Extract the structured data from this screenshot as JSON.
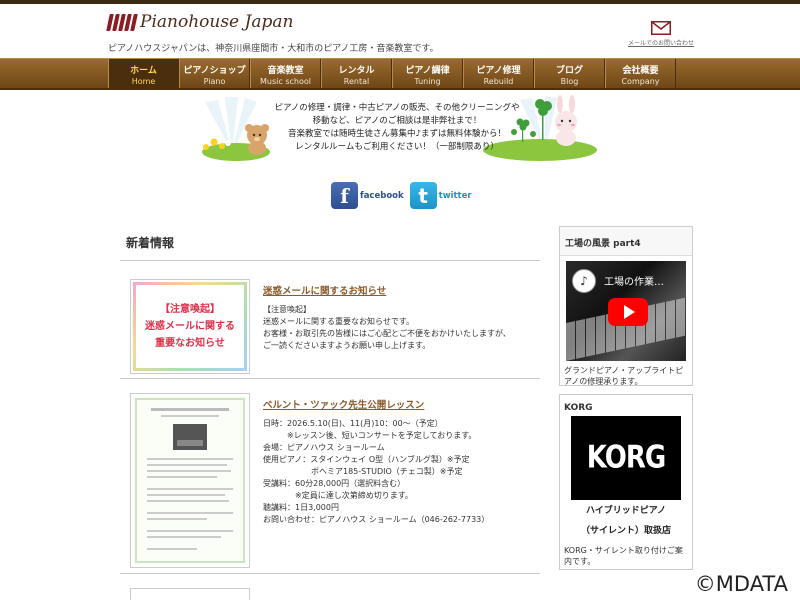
{
  "header": {
    "logo_text": "Pianohouse Japan",
    "tagline": "ピアノハウスジャパンは、神奈川県座間市・大和市のピアノ工房・音楽教室です。",
    "mail_label": "メールでのお問い合わせ",
    "mail_icon": "envelope-icon"
  },
  "nav": [
    {
      "jp": "ホーム",
      "en": "Home"
    },
    {
      "jp": "ピアノショップ",
      "en": "Piano"
    },
    {
      "jp": "音楽教室",
      "en": "Music school"
    },
    {
      "jp": "レンタル",
      "en": "Rental"
    },
    {
      "jp": "ピアノ調律",
      "en": "Tuning"
    },
    {
      "jp": "ピアノ修理",
      "en": "Rebuild"
    },
    {
      "jp": "ブログ",
      "en": "Blog"
    },
    {
      "jp": "会社概要",
      "en": "Company"
    }
  ],
  "hero": {
    "lines": [
      "ピアノの修理・調律・中古ピアノの販売、その他クリーニングや",
      "移動など、ピアノのご相談は是非弊社まで！",
      "音楽教室では随時生徒さん募集中♪まずは無料体験から！",
      "レンタルルームもご利用ください！（一部制限あり）"
    ]
  },
  "social": {
    "facebook_label": "facebook",
    "twitter_label": "twitter",
    "facebook_glyph": "f",
    "twitter_glyph": "t"
  },
  "news": {
    "title": "新着情報",
    "posts": [
      {
        "title": "迷惑メールに関するお知らせ",
        "thumb_lines": [
          "【注意喚起】",
          "迷惑メールに関する",
          "重要なお知らせ"
        ],
        "body": [
          "【注意喚起】",
          "迷惑メールに関する重要なお知らせです。",
          "お客様・お取引先の皆様にはご心配とご不便をおかけいたしますが、",
          "ご一読くださいますようお願い申し上げます。"
        ]
      },
      {
        "title": "ベルント・ツァック先生公開レッスン",
        "body": [
          "日時：2026.5.10(日)、11(月)10：00～（予定）",
          "　　　※レッスン後、短いコンサートを予定しております。",
          "会場：ピアノハウス ショールーム",
          "使用ピアノ：スタインウェイ O型（ハンブルグ製）※予定",
          "　　　　　　ボヘミア185-STUDIO（チェコ製）※予定",
          "受講料：60分28,000円（選択料含む）",
          "　　　　※定員に達し次第締め切ります。",
          "聴講料：1日3,000円",
          "お問い合わせ：ピアノハウス ショールーム（046-262-7733）"
        ]
      }
    ]
  },
  "sidebar": {
    "factory_title": "工場の風景 part4",
    "video_title": "工場の作業…",
    "factory_caption": "グランドピアノ・アップライトピアノの修理承ります。",
    "korg_title": "KORG",
    "korg_logo": "KORG",
    "korg_caption_1": "ハイブリッドピアノ",
    "korg_caption_2": "（サイレント）取扱店",
    "korg_text": "KORG・サイレント取り付けご案内です。"
  },
  "copyright": "©MDATA",
  "colors": {
    "nav_bg": "#7a4f1c",
    "nav_active_text": "#ffd84d",
    "link": "#8a5a2a",
    "warn_red": "#e0304a"
  }
}
